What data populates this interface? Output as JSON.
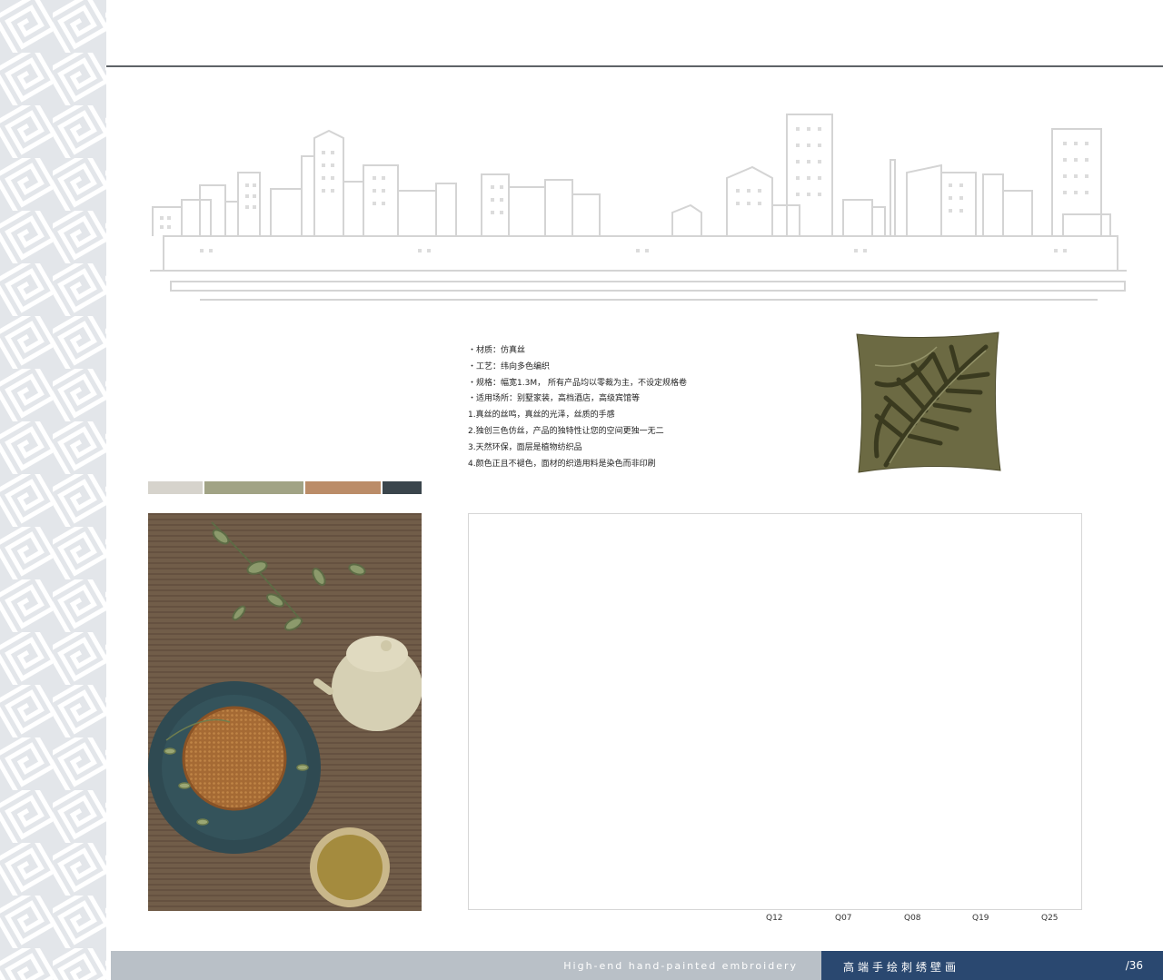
{
  "specs": [
    "・材质：仿真丝",
    "・工艺：纬向多色编织",
    "・规格：幅宽1.3M， 所有产品均以零裁为主，不设定规格卷",
    "・适用场所：别墅家装，高档酒店，高级宾馆等",
    "1.真丝的丝鸣，真丝的光泽，丝质的手感",
    "2.独创三色仿丝，产品的独特性让您的空间更独一无二",
    "3.天然环保，面层是植物纺织品",
    "4.颜色正且不褪色，面材的织造用料是染色而非印刷"
  ],
  "swatches": [
    "#d6d3cc",
    "#a1a385",
    "#bb8c68",
    "#3a454c"
  ],
  "product_codes": [
    "Q12",
    "Q07",
    "Q08",
    "Q19",
    "Q25"
  ],
  "footer": {
    "english": "High-end hand-painted embroidery",
    "chinese": "高端手绘刺绣壁画",
    "page": "/36"
  }
}
